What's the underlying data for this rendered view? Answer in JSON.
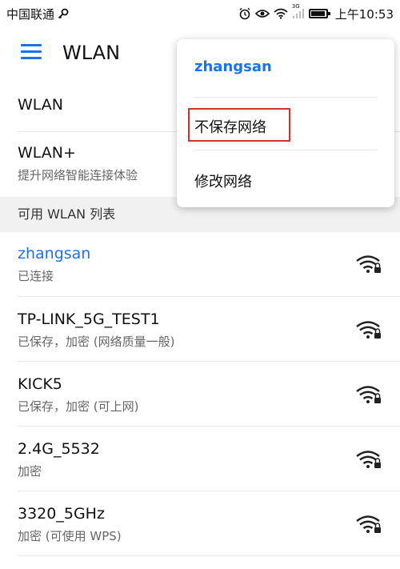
{
  "status": {
    "carrier": "中国联通",
    "network": "3G",
    "time": "上午10:53",
    "battery_level": 0.85
  },
  "appbar": {
    "title": "WLAN"
  },
  "settings": {
    "wlan": {
      "label": "WLAN"
    },
    "wlan_plus": {
      "label": "WLAN+",
      "desc": "提升网络智能连接体验"
    }
  },
  "section": {
    "title": "可用 WLAN 列表"
  },
  "networks": [
    {
      "name": "zhangsan",
      "status": "已连接",
      "active": true
    },
    {
      "name": "TP-LINK_5G_TEST1",
      "status": "已保存，加密 (网络质量一般)"
    },
    {
      "name": "KICK5",
      "status": "已保存，加密 (可上网)"
    },
    {
      "name": "2.4G_5532",
      "status": "加密"
    },
    {
      "name": "3320_5GHz",
      "status": "加密 (可使用 WPS)"
    }
  ],
  "popup": {
    "title": "zhangsan",
    "items": [
      "不保存网络",
      "修改网络"
    ]
  },
  "colors": {
    "accent": "#1a73e8",
    "highlight": "#d32f2f"
  }
}
